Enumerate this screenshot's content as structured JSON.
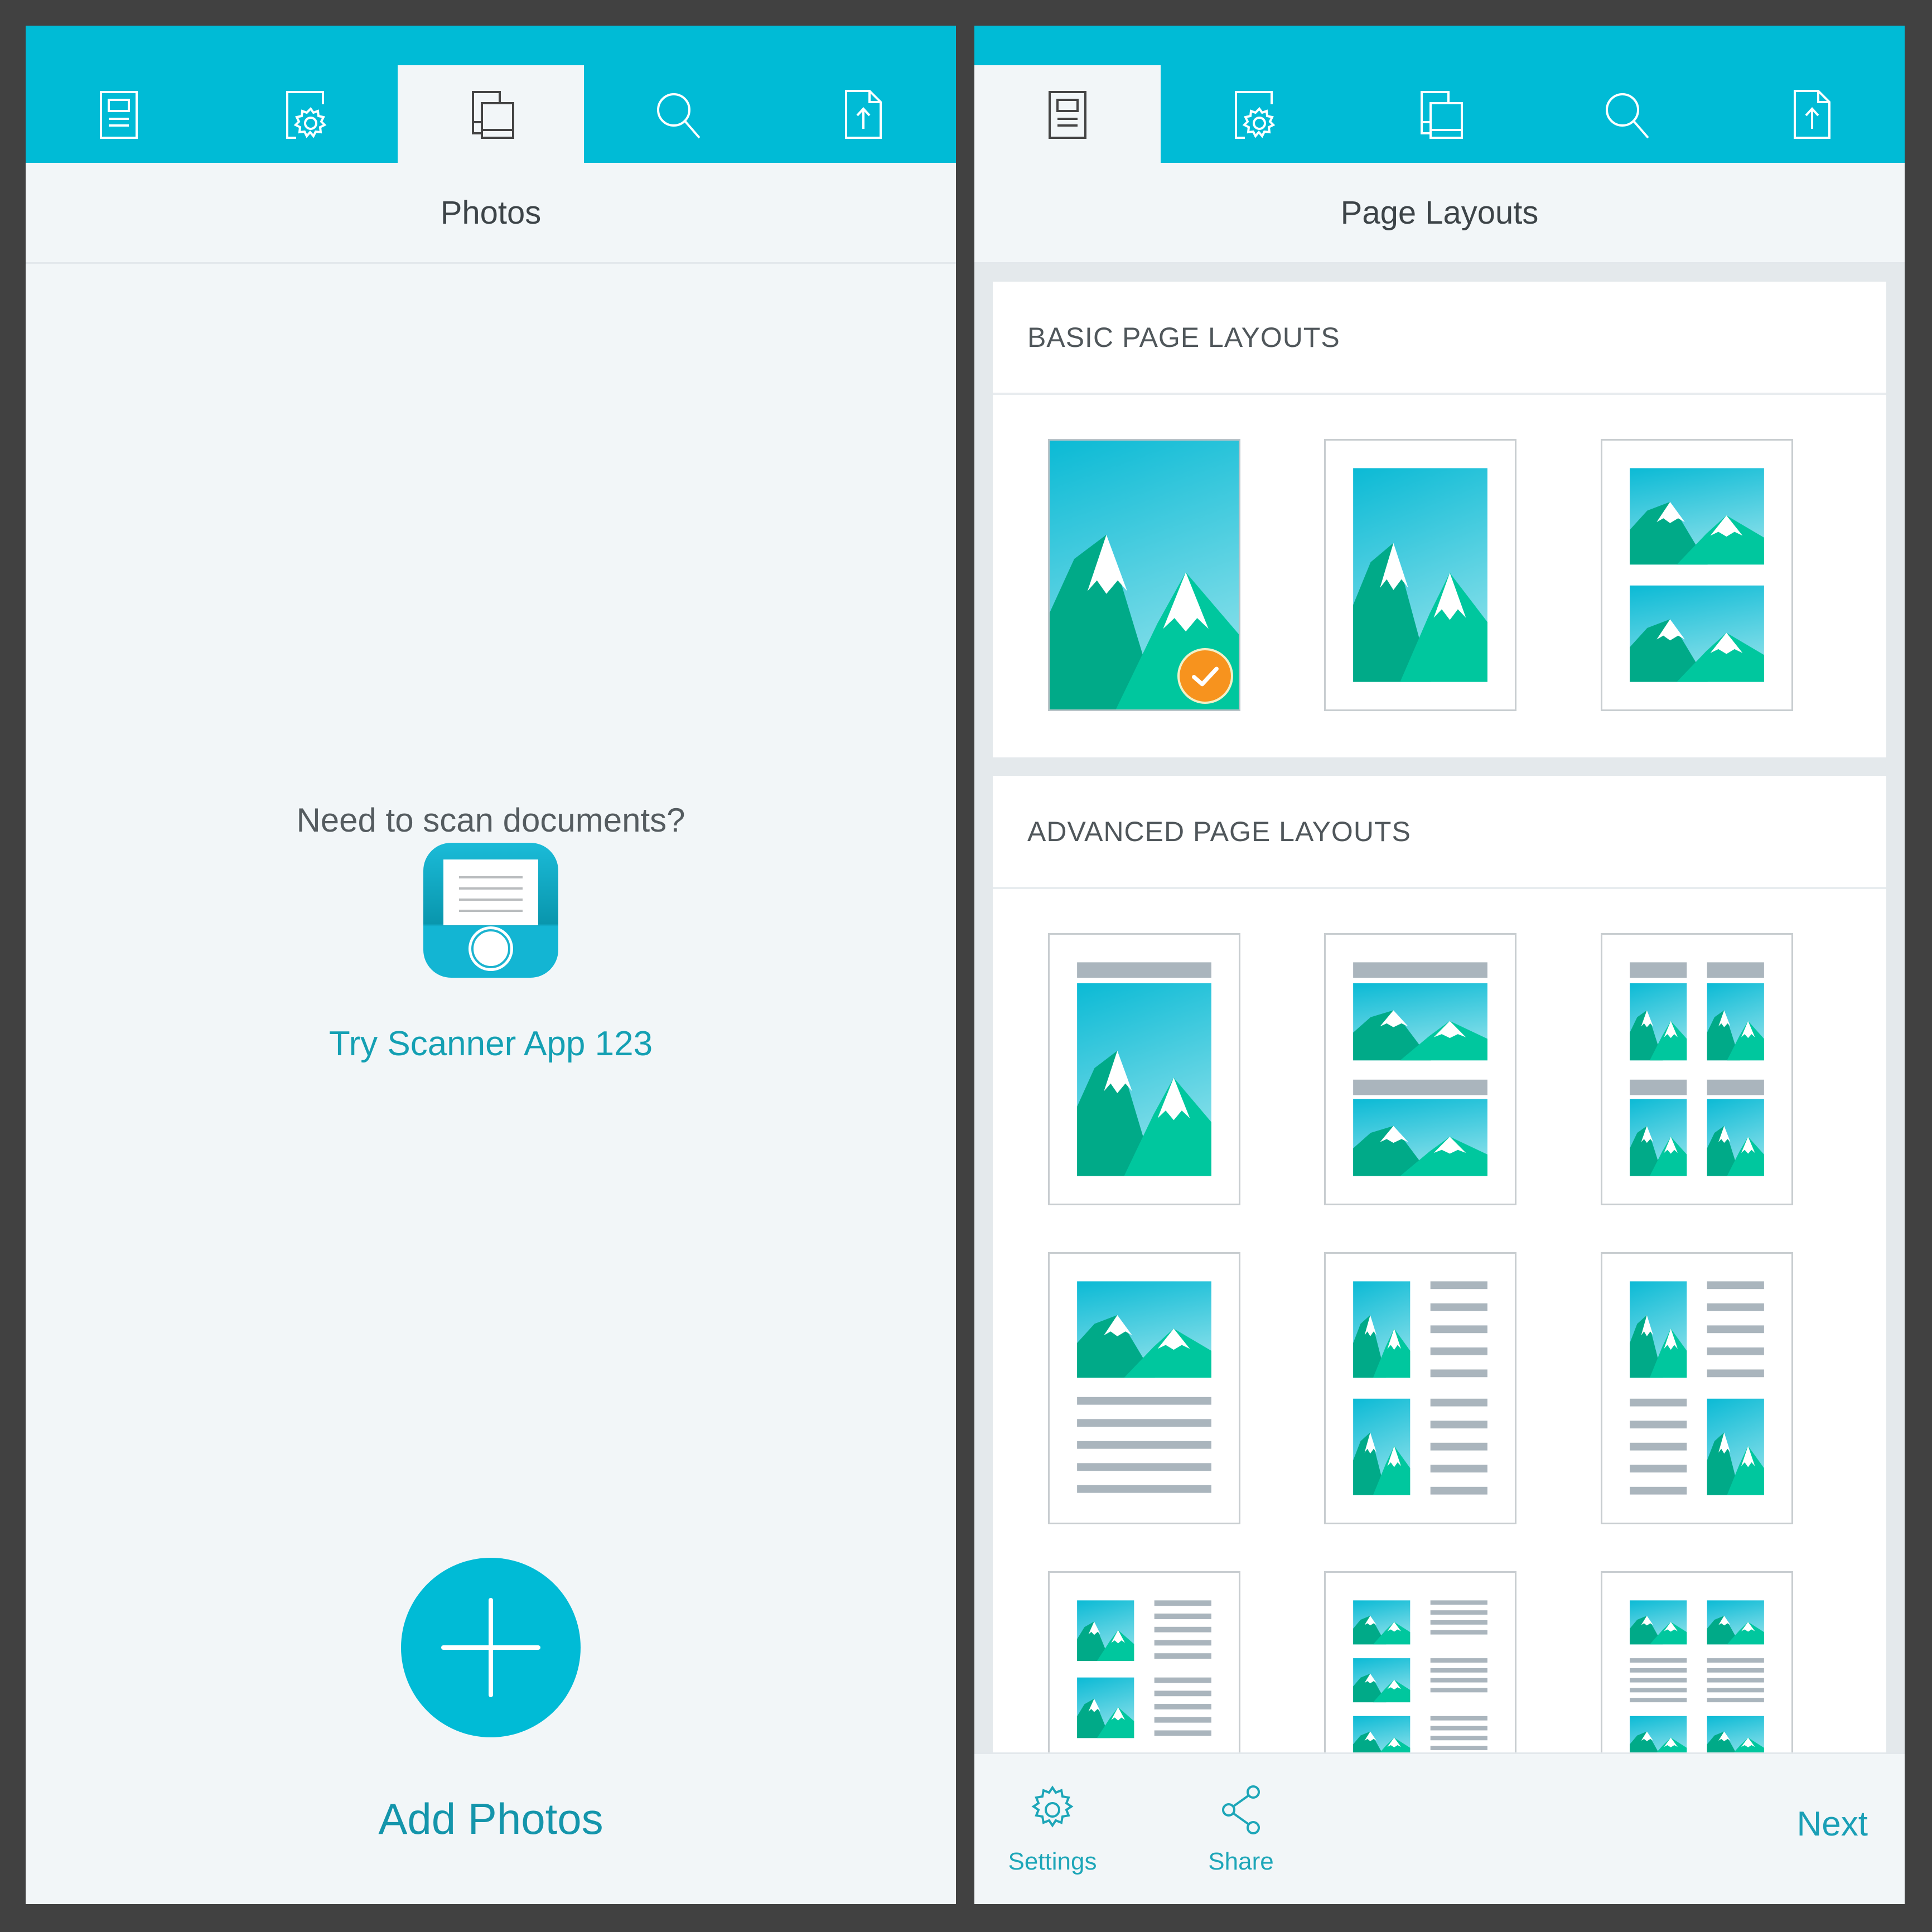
{
  "left_screen": {
    "tabs": [
      {
        "icon": "page-layout-icon",
        "active": false
      },
      {
        "icon": "page-settings-icon",
        "active": false
      },
      {
        "icon": "photos-icon",
        "active": true
      },
      {
        "icon": "search-icon",
        "active": false
      },
      {
        "icon": "export-icon",
        "active": false
      }
    ],
    "title": "Photos",
    "scan_prompt": "Need to scan documents?",
    "scanner_app_icon": "scanner-app-icon",
    "scanner_link": "Try Scanner App 123",
    "add_button_icon": "plus-icon",
    "add_label": "Add Photos"
  },
  "right_screen": {
    "tabs": [
      {
        "icon": "page-layout-icon",
        "active": true
      },
      {
        "icon": "page-settings-icon",
        "active": false
      },
      {
        "icon": "photos-icon",
        "active": false
      },
      {
        "icon": "search-icon",
        "active": false
      },
      {
        "icon": "export-icon",
        "active": false
      }
    ],
    "title": "Page Layouts",
    "basic_section": {
      "header": "BASIC PAGE LAYOUTS",
      "layouts": [
        {
          "type": "full-bleed-photo",
          "selected": true
        },
        {
          "type": "single-photo-margin",
          "selected": false
        },
        {
          "type": "two-photos-stacked",
          "selected": false
        }
      ]
    },
    "advanced_section": {
      "header": "ADVANCED PAGE LAYOUTS",
      "layouts": [
        {
          "type": "captioned-photo"
        },
        {
          "type": "two-captioned-photos"
        },
        {
          "type": "four-captioned-photos"
        },
        {
          "type": "photo-over-text"
        },
        {
          "type": "two-photos-left-text-right"
        },
        {
          "type": "alternating-photo-text"
        },
        {
          "type": "two-small-photos-text"
        },
        {
          "type": "three-small-photos-text"
        },
        {
          "type": "four-photos-two-column-text"
        }
      ]
    },
    "bottom_bar": {
      "settings_label": "Settings",
      "settings_icon": "gear-icon",
      "share_label": "Share",
      "share_icon": "share-icon",
      "next_label": "Next"
    }
  },
  "colors": {
    "brand": "#00bbd6",
    "accent_text": "#1a9fb6",
    "selected_badge": "#f7931e",
    "sky_top": "#0bbad5",
    "sky_bottom": "#8ae0ea",
    "mountain_dark": "#00aa88",
    "mountain_light": "#00c79e",
    "text_line": "#aab5bd"
  }
}
